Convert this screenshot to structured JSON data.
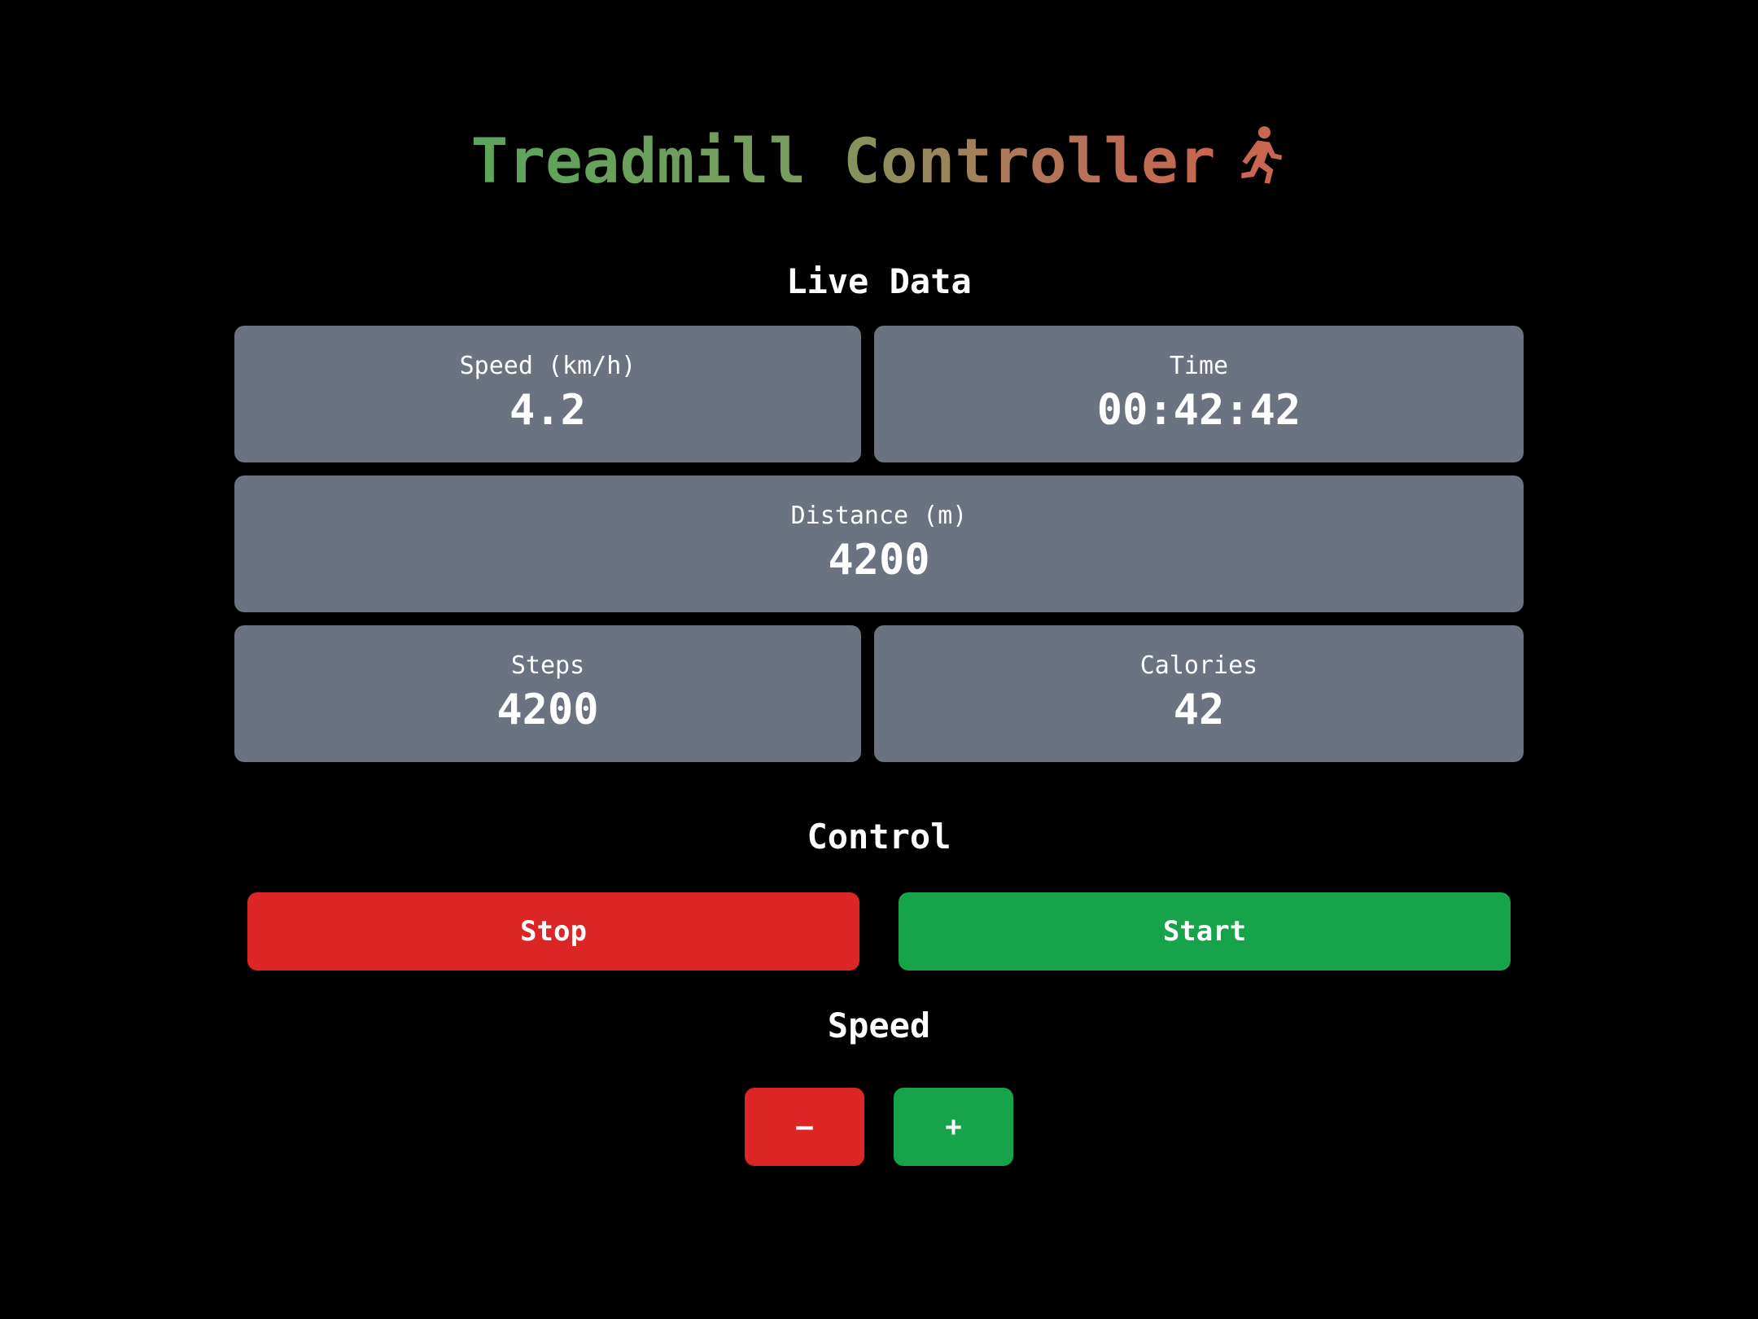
{
  "app": {
    "title": "Treadmill Controller",
    "title_icon": "running-person-icon"
  },
  "live_data": {
    "heading": "Live Data",
    "speed": {
      "label": "Speed (km/h)",
      "value": "4.2"
    },
    "time": {
      "label": "Time",
      "value": "00:42:42"
    },
    "distance": {
      "label": "Distance (m)",
      "value": "4200"
    },
    "steps": {
      "label": "Steps",
      "value": "4200"
    },
    "calories": {
      "label": "Calories",
      "value": "42"
    }
  },
  "control": {
    "heading": "Control",
    "stop_label": "Stop",
    "start_label": "Start"
  },
  "speed_control": {
    "heading": "Speed",
    "decrease_label": "–",
    "increase_label": "+"
  },
  "colors": {
    "background": "#000000",
    "card": "#6b7280",
    "danger": "#dc2626",
    "success": "#16a34a",
    "title_gradient_start": "#5aa65a",
    "title_gradient_end": "#c9664f"
  }
}
